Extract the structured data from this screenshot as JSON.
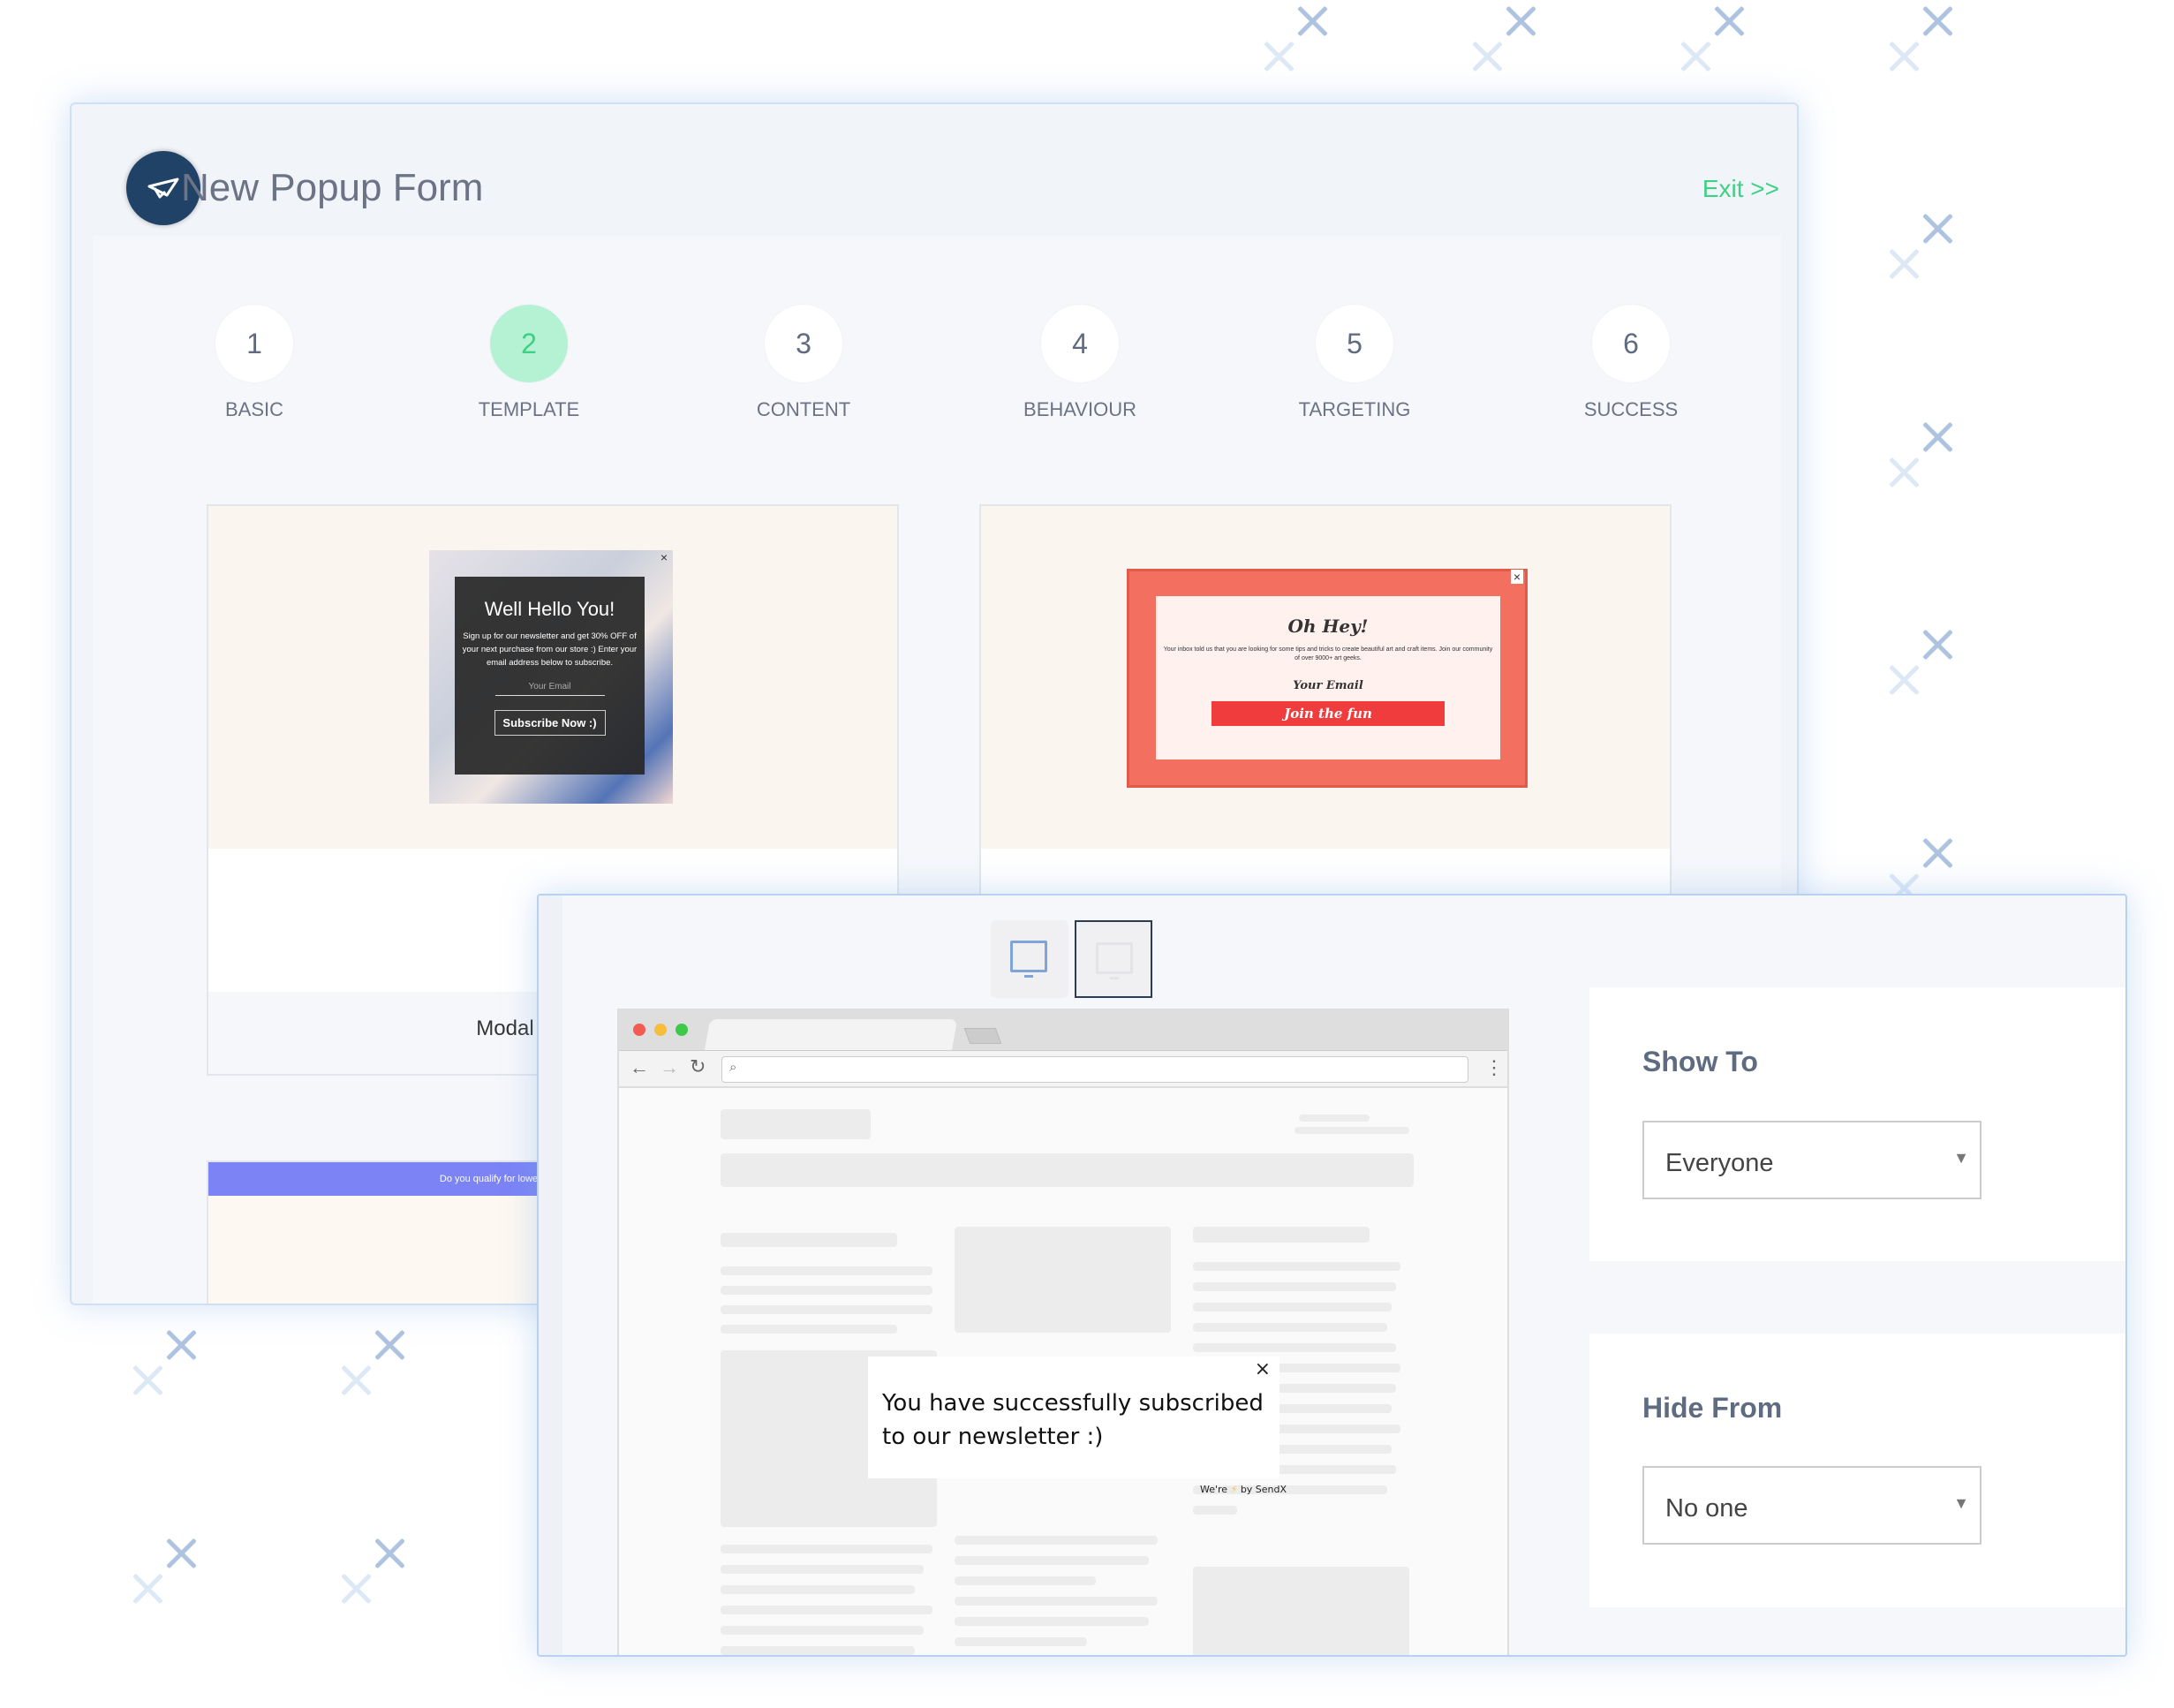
{
  "header": {
    "title": "New Popup Form",
    "exit_label": "Exit >>",
    "logo_icon": "paper-plane-icon"
  },
  "steps": [
    {
      "number": "1",
      "label": "BASIC"
    },
    {
      "number": "2",
      "label": "TEMPLATE",
      "active": true
    },
    {
      "number": "3",
      "label": "CONTENT"
    },
    {
      "number": "4",
      "label": "BEHAVIOUR"
    },
    {
      "number": "5",
      "label": "TARGETING"
    },
    {
      "number": "6",
      "label": "SUCCESS"
    }
  ],
  "templates": [
    {
      "label": "Modal Backgrou",
      "preview": {
        "title": "Well Hello You!",
        "body": "Sign up for our newsletter and get 30% OFF of your next purchase from our store :) Enter your email address below to subscribe.",
        "email_placeholder": "Your Email",
        "button": "Subscribe Now :)",
        "close": "×"
      }
    },
    {
      "preview": {
        "title": "Oh Hey!",
        "body": "Your inbox told us that you are looking for some tips and tricks to create beautiful art and craft items. Join our community of over 9000+ art geeks.",
        "email_placeholder": "Your Email",
        "button": "Join the fun",
        "close": "×"
      }
    },
    {
      "banner": "Do you qualify for lower student loan? Enter your em"
    }
  ],
  "preview": {
    "devices": [
      "desktop-icon",
      "mobile-icon"
    ],
    "success_message": "You have successfully subscribed to our newsletter :)",
    "close": "×",
    "powered_pre": "We're",
    "powered_icon": "⚡",
    "powered_post": "by SendX"
  },
  "targeting": {
    "show_to": {
      "label": "Show To",
      "value": "Everyone"
    },
    "hide_from": {
      "label": "Hide From",
      "value": "No one"
    }
  },
  "colors": {
    "accent": "#3fcf85",
    "brand": "#1f4266",
    "banner": "#7b83f5"
  }
}
